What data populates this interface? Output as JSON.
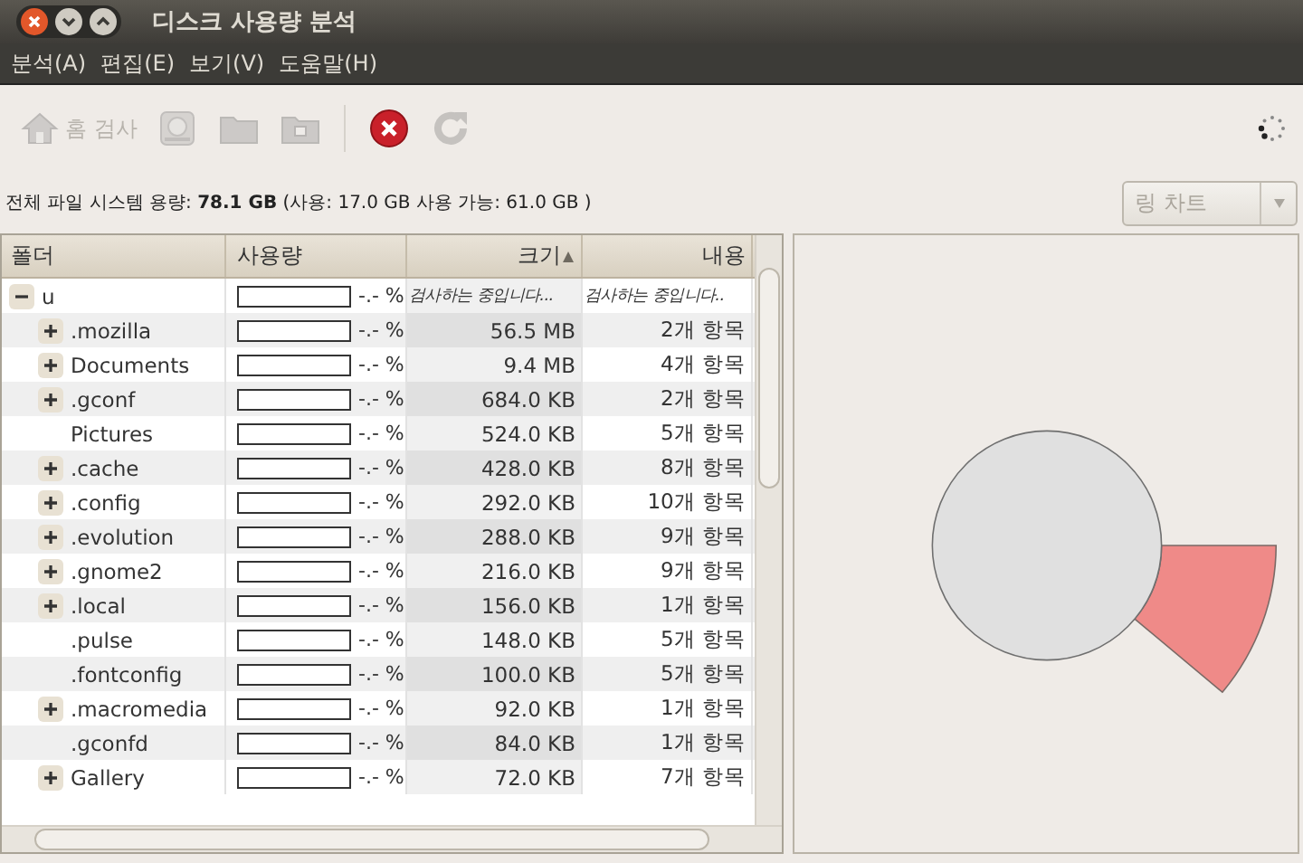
{
  "window": {
    "title": "디스크 사용량 분석"
  },
  "menu": [
    "분석(A)",
    "편집(E)",
    "보기(V)",
    "도움말(H)"
  ],
  "toolbar": [
    {
      "kind": "home",
      "label": "홈 검사",
      "disabled": true
    },
    {
      "kind": "drive",
      "disabled": true
    },
    {
      "kind": "folder",
      "disabled": true
    },
    {
      "kind": "remote",
      "disabled": true
    },
    {
      "kind": "stop",
      "disabled": false
    },
    {
      "kind": "refresh",
      "disabled": true
    }
  ],
  "busy": true,
  "summary": "전체 파일 시스템 용량: **78.1 GB** (사용: 17.0 GB 사용 가능: 61.0 GB )",
  "chart_type": {
    "value": "링 차트",
    "disabled": true
  },
  "table": {
    "columns": [
      {
        "label": "폴더",
        "sorted": false
      },
      {
        "label": "사용량",
        "sorted": false
      },
      {
        "label": "크기",
        "sorted": true
      },
      {
        "label": "내용",
        "sorted": false
      }
    ],
    "rows": [
      {
        "name": "u",
        "has_children": true,
        "expanded": true,
        "percent": "-.- %",
        "size": "검사하는 중입니다...",
        "contents": "검사하는 중입니다..",
        "pending": true,
        "children": [
          {
            "name": ".mozilla",
            "has_children": true,
            "expanded": false,
            "percent": "-.- %",
            "size": "56.5 MB",
            "contents": "2개 항목",
            "pending": false
          },
          {
            "name": "Documents",
            "has_children": true,
            "expanded": false,
            "percent": "-.- %",
            "size": "9.4 MB",
            "contents": "4개 항목",
            "pending": false
          },
          {
            "name": ".gconf",
            "has_children": true,
            "expanded": false,
            "percent": "-.- %",
            "size": "684.0 KB",
            "contents": "2개 항목",
            "pending": false
          },
          {
            "name": "Pictures",
            "has_children": false,
            "percent": "-.- %",
            "size": "524.0 KB",
            "contents": "5개 항목",
            "pending": false
          },
          {
            "name": ".cache",
            "has_children": true,
            "expanded": false,
            "percent": "-.- %",
            "size": "428.0 KB",
            "contents": "8개 항목",
            "pending": false
          },
          {
            "name": ".config",
            "has_children": true,
            "expanded": false,
            "percent": "-.- %",
            "size": "292.0 KB",
            "contents": "10개 항목",
            "pending": false
          },
          {
            "name": ".evolution",
            "has_children": true,
            "expanded": false,
            "percent": "-.- %",
            "size": "288.0 KB",
            "contents": "9개 항목",
            "pending": false
          },
          {
            "name": ".gnome2",
            "has_children": true,
            "expanded": false,
            "percent": "-.- %",
            "size": "216.0 KB",
            "contents": "9개 항목",
            "pending": false
          },
          {
            "name": ".local",
            "has_children": true,
            "expanded": false,
            "percent": "-.- %",
            "size": "156.0 KB",
            "contents": "1개 항목",
            "pending": false
          },
          {
            "name": ".pulse",
            "has_children": false,
            "percent": "-.- %",
            "size": "148.0 KB",
            "contents": "5개 항목",
            "pending": false
          },
          {
            "name": ".fontconfig",
            "has_children": false,
            "percent": "-.- %",
            "size": "100.0 KB",
            "contents": "5개 항목",
            "pending": false
          },
          {
            "name": ".macromedia",
            "has_children": true,
            "expanded": false,
            "percent": "-.- %",
            "size": "92.0 KB",
            "contents": "1개 항목",
            "pending": false
          },
          {
            "name": ".gconfd",
            "has_children": false,
            "percent": "-.- %",
            "size": "84.0 KB",
            "contents": "1개 항목",
            "pending": false
          },
          {
            "name": "Gallery",
            "has_children": true,
            "expanded": false,
            "percent": "-.- %",
            "size": "72.0 KB",
            "contents": "7개 항목",
            "pending": false
          }
        ]
      }
    ]
  }
}
